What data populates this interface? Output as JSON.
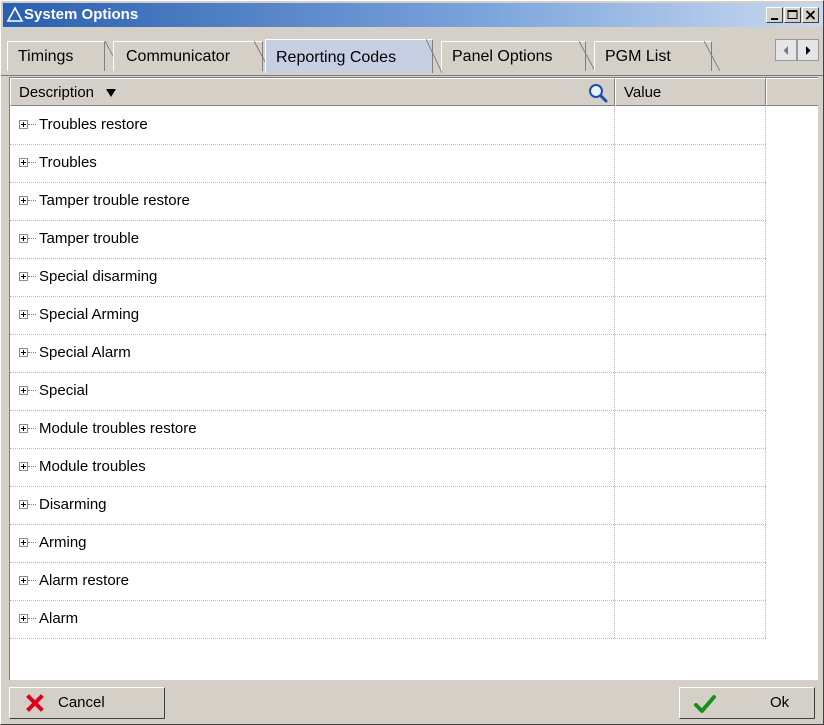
{
  "window": {
    "title": "System Options"
  },
  "tabs": [
    {
      "label": "Timings"
    },
    {
      "label": "Communicator"
    },
    {
      "label": "Reporting Codes",
      "active": true
    },
    {
      "label": "Panel Options"
    },
    {
      "label": "PGM List"
    }
  ],
  "grid": {
    "columns": {
      "description": "Description",
      "value": "Value"
    },
    "rows": [
      {
        "label": "Troubles restore"
      },
      {
        "label": "Troubles"
      },
      {
        "label": "Tamper trouble restore"
      },
      {
        "label": "Tamper trouble"
      },
      {
        "label": "Special disarming"
      },
      {
        "label": "Special Arming"
      },
      {
        "label": "Special Alarm"
      },
      {
        "label": "Special"
      },
      {
        "label": "Module troubles restore"
      },
      {
        "label": "Module troubles"
      },
      {
        "label": "Disarming"
      },
      {
        "label": "Arming"
      },
      {
        "label": "Alarm restore"
      },
      {
        "label": "Alarm"
      }
    ]
  },
  "buttons": {
    "cancel": "Cancel",
    "ok": "Ok"
  },
  "colors": {
    "titlebar": "#2a5fb0",
    "active_tab": "#c7cfe2",
    "cancel_icon": "#e0001b",
    "ok_icon": "#1b8f1b"
  }
}
